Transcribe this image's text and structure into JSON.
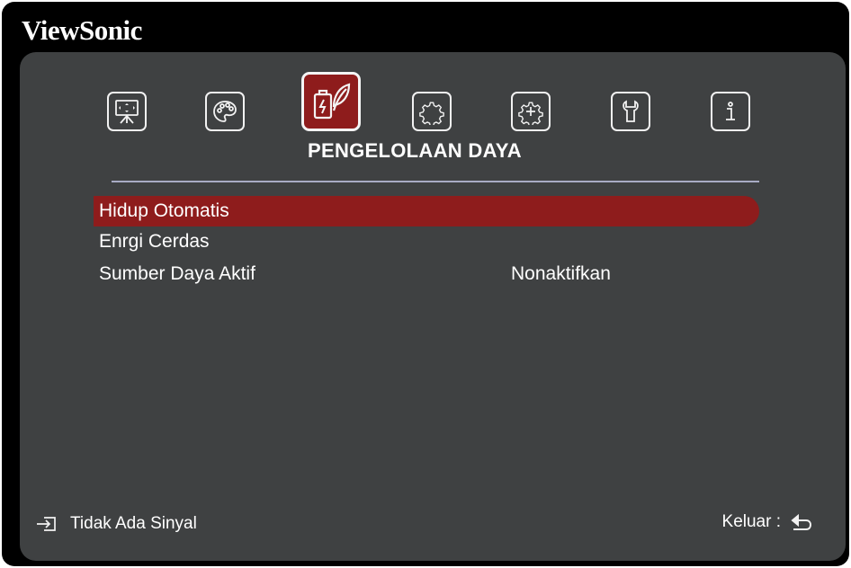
{
  "brand": "ViewSonic",
  "tabs": [
    {
      "name": "display-icon",
      "active": false
    },
    {
      "name": "palette-icon",
      "active": false
    },
    {
      "name": "power-leaf-icon",
      "active": true
    },
    {
      "name": "gear-icon",
      "active": false
    },
    {
      "name": "gear-plus-icon",
      "active": false
    },
    {
      "name": "wrench-icon",
      "active": false
    },
    {
      "name": "info-icon",
      "active": false
    }
  ],
  "active_tab_title": "PENGELOLAAN DAYA",
  "menu": {
    "items": [
      {
        "label": "Hidup Otomatis",
        "value": "",
        "selected": true
      },
      {
        "label": "Enrgi Cerdas",
        "value": "",
        "selected": false
      },
      {
        "label": "Sumber Daya Aktif",
        "value": "Nonaktifkan",
        "selected": false
      }
    ]
  },
  "footer": {
    "signal_text": "Tidak Ada Sinyal",
    "signal_icon": "input-source-icon",
    "exit_label": "Keluar :",
    "exit_icon": "return-arrow-icon"
  },
  "colors": {
    "panel": "#3f4142",
    "highlight": "#8e1c1c",
    "text": "#ffffff",
    "rule": "#a8abc4"
  }
}
